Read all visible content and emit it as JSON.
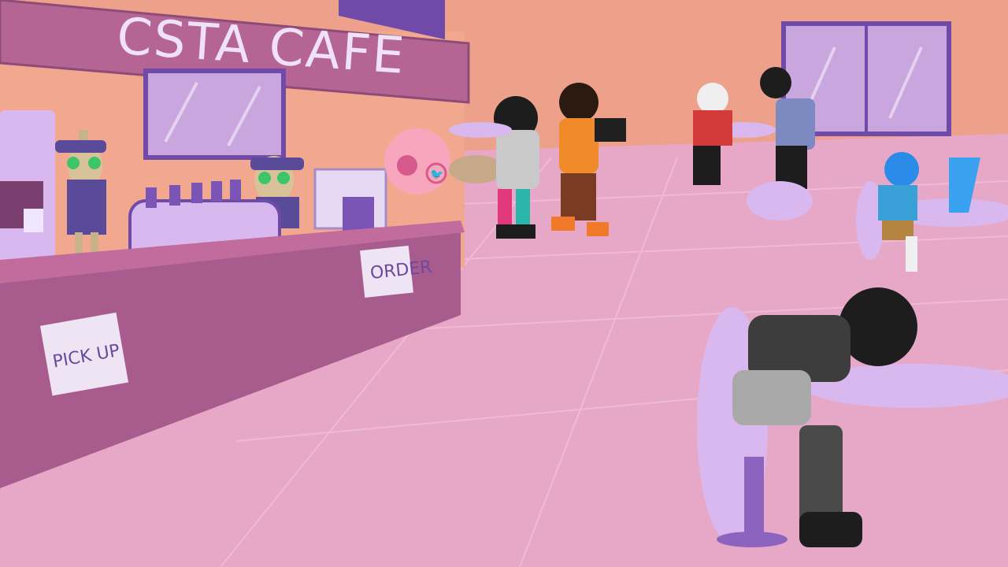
{
  "scene": {
    "cafe_sign": "CSTA CAFE",
    "order_card": "ORDER",
    "pickup_card": "PICK UP",
    "palette": {
      "wall": "#eda08a",
      "floor": "#e7a8c8",
      "counter": "#b46594",
      "furniture": "#d8b8ee",
      "accent_purple": "#6f4aa8"
    },
    "icons": [
      "peach-emoji-bubble",
      "twitter-bird-icon"
    ]
  }
}
